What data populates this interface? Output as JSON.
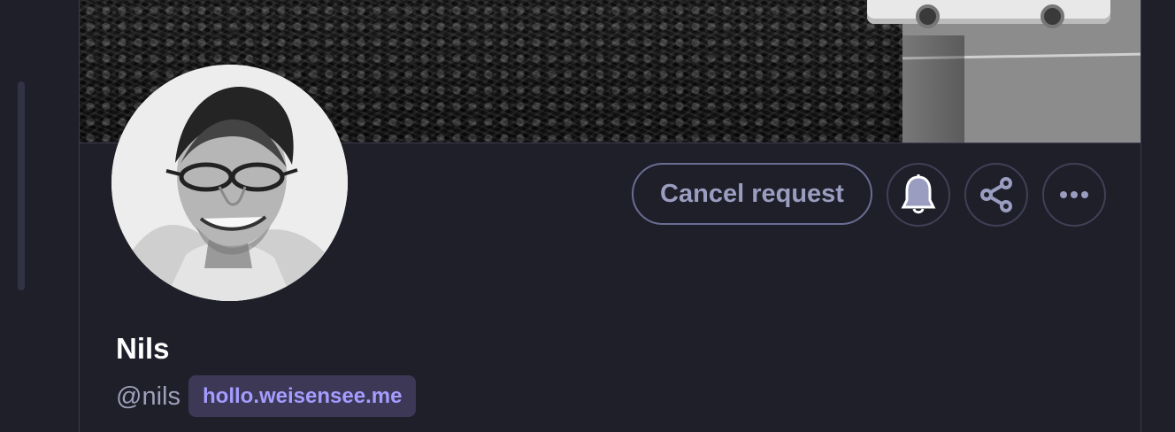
{
  "profile": {
    "display_name": "Nils",
    "handle": "@nils",
    "domain": "hollo.weisensee.me"
  },
  "actions": {
    "cancel_request_label": "Cancel request",
    "notification_icon": "bell-icon",
    "share_icon": "share-icon",
    "more_icon": "ellipsis-icon"
  },
  "colors": {
    "background": "#1f1f2a",
    "button_text": "#9a9dbf",
    "domain_badge_background": "#3c3856",
    "domain_badge_text": "#a59cff"
  }
}
